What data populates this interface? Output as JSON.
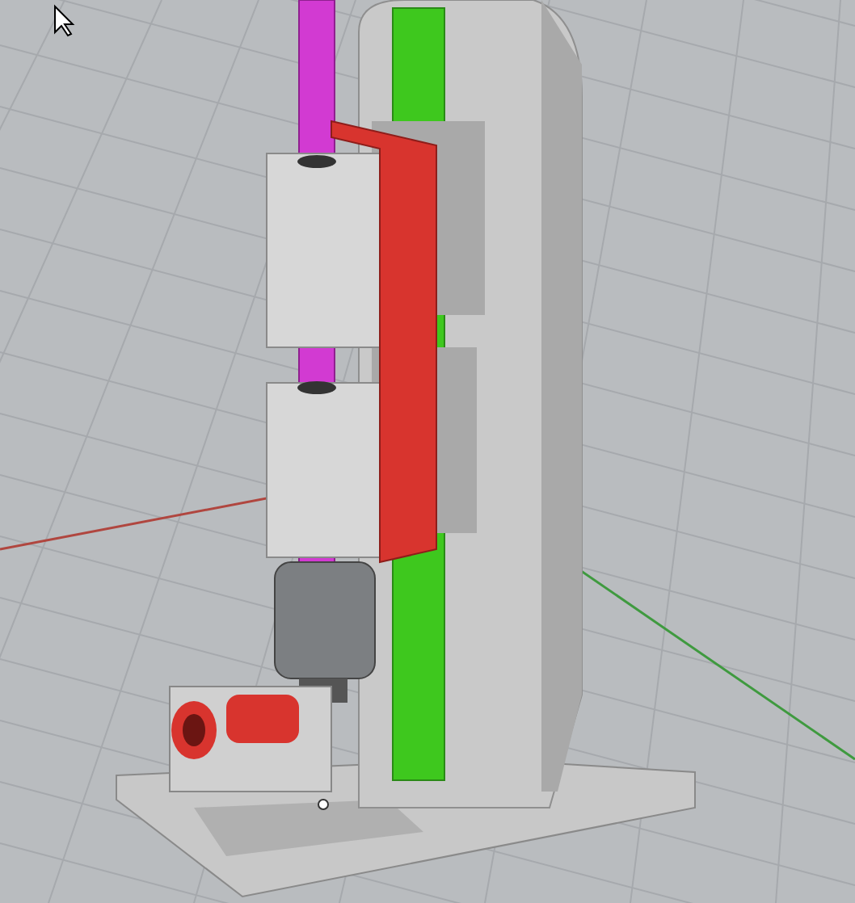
{
  "viewport": {
    "grid": true,
    "axes": true,
    "cursor": true
  }
}
